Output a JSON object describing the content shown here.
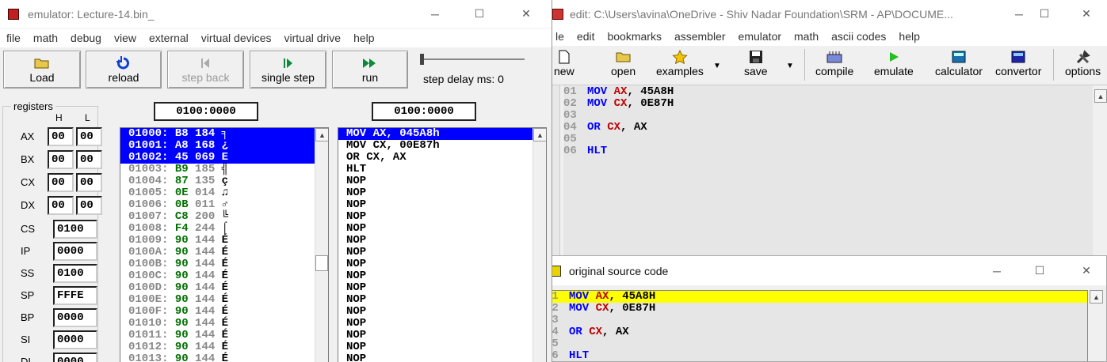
{
  "emulator": {
    "title": "emulator: Lecture-14.bin_",
    "menu": [
      "file",
      "math",
      "debug",
      "view",
      "external",
      "virtual devices",
      "virtual drive",
      "help"
    ],
    "buttons": {
      "load": "Load",
      "reload": "reload",
      "step_back": "step back",
      "single_step": "single step",
      "run": "run"
    },
    "step_delay_label": "step delay ms: 0",
    "registers_label": "registers",
    "col_h": "H",
    "col_l": "L",
    "regs8": [
      {
        "name": "AX",
        "h": "00",
        "l": "00"
      },
      {
        "name": "BX",
        "h": "00",
        "l": "00"
      },
      {
        "name": "CX",
        "h": "00",
        "l": "00"
      },
      {
        "name": "DX",
        "h": "00",
        "l": "00"
      }
    ],
    "regs16": [
      {
        "name": "CS",
        "v": "0100"
      },
      {
        "name": "IP",
        "v": "0000"
      },
      {
        "name": "SS",
        "v": "0100"
      },
      {
        "name": "SP",
        "v": "FFFE"
      },
      {
        "name": "BP",
        "v": "0000"
      },
      {
        "name": "SI",
        "v": "0000"
      },
      {
        "name": "DI",
        "v": "0000"
      }
    ],
    "mem_addr": "0100:0000",
    "dis_addr": "0100:0000",
    "memory": [
      {
        "a": "01000:",
        "h": "B8",
        "d": "184",
        "c": "╕",
        "sel": true
      },
      {
        "a": "01001:",
        "h": "A8",
        "d": "168",
        "c": "¿",
        "sel": true
      },
      {
        "a": "01002:",
        "h": "45",
        "d": "069",
        "c": "E",
        "sel": true
      },
      {
        "a": "01003:",
        "h": "B9",
        "d": "185",
        "c": "╣"
      },
      {
        "a": "01004:",
        "h": "87",
        "d": "135",
        "c": "ç"
      },
      {
        "a": "01005:",
        "h": "0E",
        "d": "014",
        "c": "♫"
      },
      {
        "a": "01006:",
        "h": "0B",
        "d": "011",
        "c": "♂"
      },
      {
        "a": "01007:",
        "h": "C8",
        "d": "200",
        "c": "╚"
      },
      {
        "a": "01008:",
        "h": "F4",
        "d": "244",
        "c": "⌠"
      },
      {
        "a": "01009:",
        "h": "90",
        "d": "144",
        "c": "É"
      },
      {
        "a": "0100A:",
        "h": "90",
        "d": "144",
        "c": "É"
      },
      {
        "a": "0100B:",
        "h": "90",
        "d": "144",
        "c": "É"
      },
      {
        "a": "0100C:",
        "h": "90",
        "d": "144",
        "c": "É"
      },
      {
        "a": "0100D:",
        "h": "90",
        "d": "144",
        "c": "É"
      },
      {
        "a": "0100E:",
        "h": "90",
        "d": "144",
        "c": "É"
      },
      {
        "a": "0100F:",
        "h": "90",
        "d": "144",
        "c": "É"
      },
      {
        "a": "01010:",
        "h": "90",
        "d": "144",
        "c": "É"
      },
      {
        "a": "01011:",
        "h": "90",
        "d": "144",
        "c": "É"
      },
      {
        "a": "01012:",
        "h": "90",
        "d": "144",
        "c": "É"
      },
      {
        "a": "01013:",
        "h": "90",
        "d": "144",
        "c": "É"
      }
    ],
    "disasm": [
      "MOV AX, 045A8h",
      "MOV CX, 00E87h",
      "OR CX, AX",
      "HLT",
      "NOP",
      "NOP",
      "NOP",
      "NOP",
      "NOP",
      "NOP",
      "NOP",
      "NOP",
      "NOP",
      "NOP",
      "NOP",
      "NOP",
      "NOP",
      "NOP",
      "NOP",
      "NOP"
    ]
  },
  "editor": {
    "title": "edit: C:\\Users\\avina\\OneDrive - Shiv Nadar Foundation\\SRM - AP\\DOCUME...",
    "menu": [
      "le",
      "edit",
      "bookmarks",
      "assembler",
      "emulator",
      "math",
      "ascii codes",
      "help"
    ],
    "tools": {
      "new": "new",
      "open": "open",
      "examples": "examples",
      "save": "save",
      "compile": "compile",
      "emulate": "emulate",
      "calculator": "calculator",
      "convertor": "convertor",
      "options": "options"
    },
    "lines": [
      {
        "n": "01",
        "a": "MOV",
        "b": "AX",
        "c": ", 45A8H"
      },
      {
        "n": "02",
        "a": "MOV",
        "b": "CX",
        "c": ", 0E87H"
      },
      {
        "n": "03",
        "a": "",
        "b": "",
        "c": ""
      },
      {
        "n": "04",
        "a": "OR",
        "b": "CX",
        "c": ", AX"
      },
      {
        "n": "05",
        "a": "",
        "b": "",
        "c": ""
      },
      {
        "n": "06",
        "a": "HLT",
        "b": "",
        "c": ""
      }
    ]
  },
  "source": {
    "title": "original source code",
    "lines": [
      {
        "n": "01",
        "a": "MOV",
        "b": "AX",
        "c": ", 45A8H"
      },
      {
        "n": "02",
        "a": "MOV",
        "b": "CX",
        "c": ", 0E87H"
      },
      {
        "n": "03",
        "a": "",
        "b": "",
        "c": ""
      },
      {
        "n": "04",
        "a": "OR",
        "b": "CX",
        "c": ", AX"
      },
      {
        "n": "05",
        "a": "",
        "b": "",
        "c": ""
      },
      {
        "n": "06",
        "a": "HLT",
        "b": "",
        "c": ""
      }
    ]
  }
}
